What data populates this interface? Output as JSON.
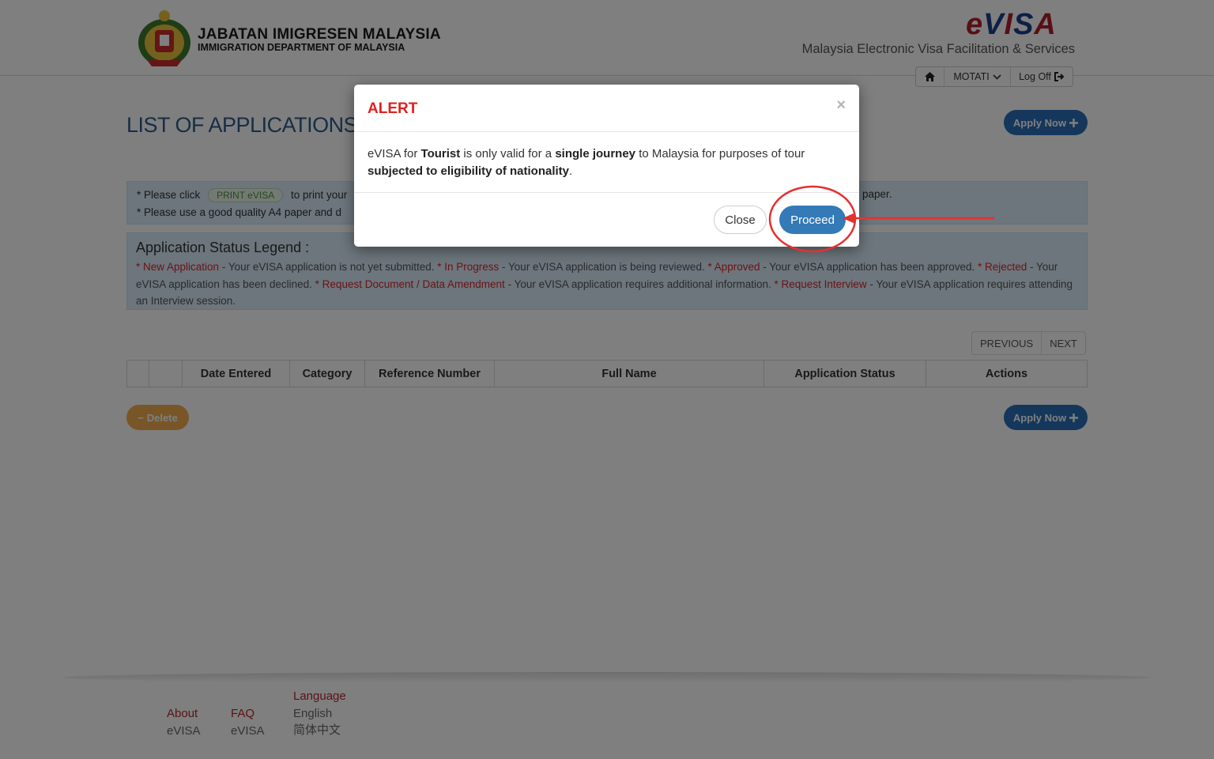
{
  "header": {
    "org_name": "JABATAN IMIGRESEN MALAYSIA",
    "org_name_en": "IMMIGRATION DEPARTMENT OF MALAYSIA",
    "logo": [
      "e",
      "V",
      "I",
      "S",
      "A"
    ],
    "subtitle": "Malaysia Electronic Visa Facilitation & Services",
    "username": "MOTATI",
    "logoff_label": "Log Off"
  },
  "main": {
    "title": "LIST OF APPLICATIONS",
    "apply_label": "Apply Now",
    "info": {
      "line1_start": "* Please click",
      "print_chip": "PRINT eVISA",
      "line1_mid": "to print your",
      "line1_end": "paper.",
      "line2": "* Please use a good quality A4 paper and d"
    },
    "legend": {
      "title": "Application Status Legend :",
      "items": [
        {
          "label": "* New Application",
          "desc": " - Your eVISA application is not yet submitted. "
        },
        {
          "label": "* In Progress",
          "desc": " - Your eVISA application is being reviewed. "
        },
        {
          "label": "* Approved",
          "desc": " - Your eVISA application has been approved. "
        },
        {
          "label": "* Rejected",
          "desc": " - Your eVISA application has been declined. "
        },
        {
          "label": "* Request Document / Data Amendment",
          "desc": " - Your eVISA application requires additional information. "
        },
        {
          "label": "* Request Interview",
          "desc": "  - Your eVISA application requires attending an Interview session."
        }
      ]
    },
    "pager": {
      "previous": "PREVIOUS",
      "next": "NEXT"
    },
    "table_headers": [
      "",
      "",
      "Date Entered",
      "Category",
      "Reference Number",
      "Full Name",
      "Application Status",
      "Actions"
    ],
    "delete_label": "Delete"
  },
  "footer": {
    "about": {
      "heading": "About",
      "sub": "eVISA"
    },
    "faq": {
      "heading": "FAQ",
      "sub": "eVISA"
    },
    "language": {
      "heading": "Language",
      "options": [
        "English",
        "简体中文"
      ]
    }
  },
  "modal": {
    "title": "ALERT",
    "close_x": "×",
    "body_parts": [
      {
        "text": "eVISA for ",
        "bold": false
      },
      {
        "text": "Tourist",
        "bold": true
      },
      {
        "text": " is only valid for a ",
        "bold": false
      },
      {
        "text": "single journey",
        "bold": true
      },
      {
        "text": " to Malaysia for purposes of tour ",
        "bold": false
      },
      {
        "text": "subjected to eligibility of nationality",
        "bold": true
      },
      {
        "text": ".",
        "bold": false
      }
    ],
    "close_label": "Close",
    "proceed_label": "Proceed"
  },
  "colors": {
    "accent": "#337ab7",
    "alert_red": "#e02020",
    "annotation_red": "#e53030",
    "legend_red": "#d7262b"
  }
}
